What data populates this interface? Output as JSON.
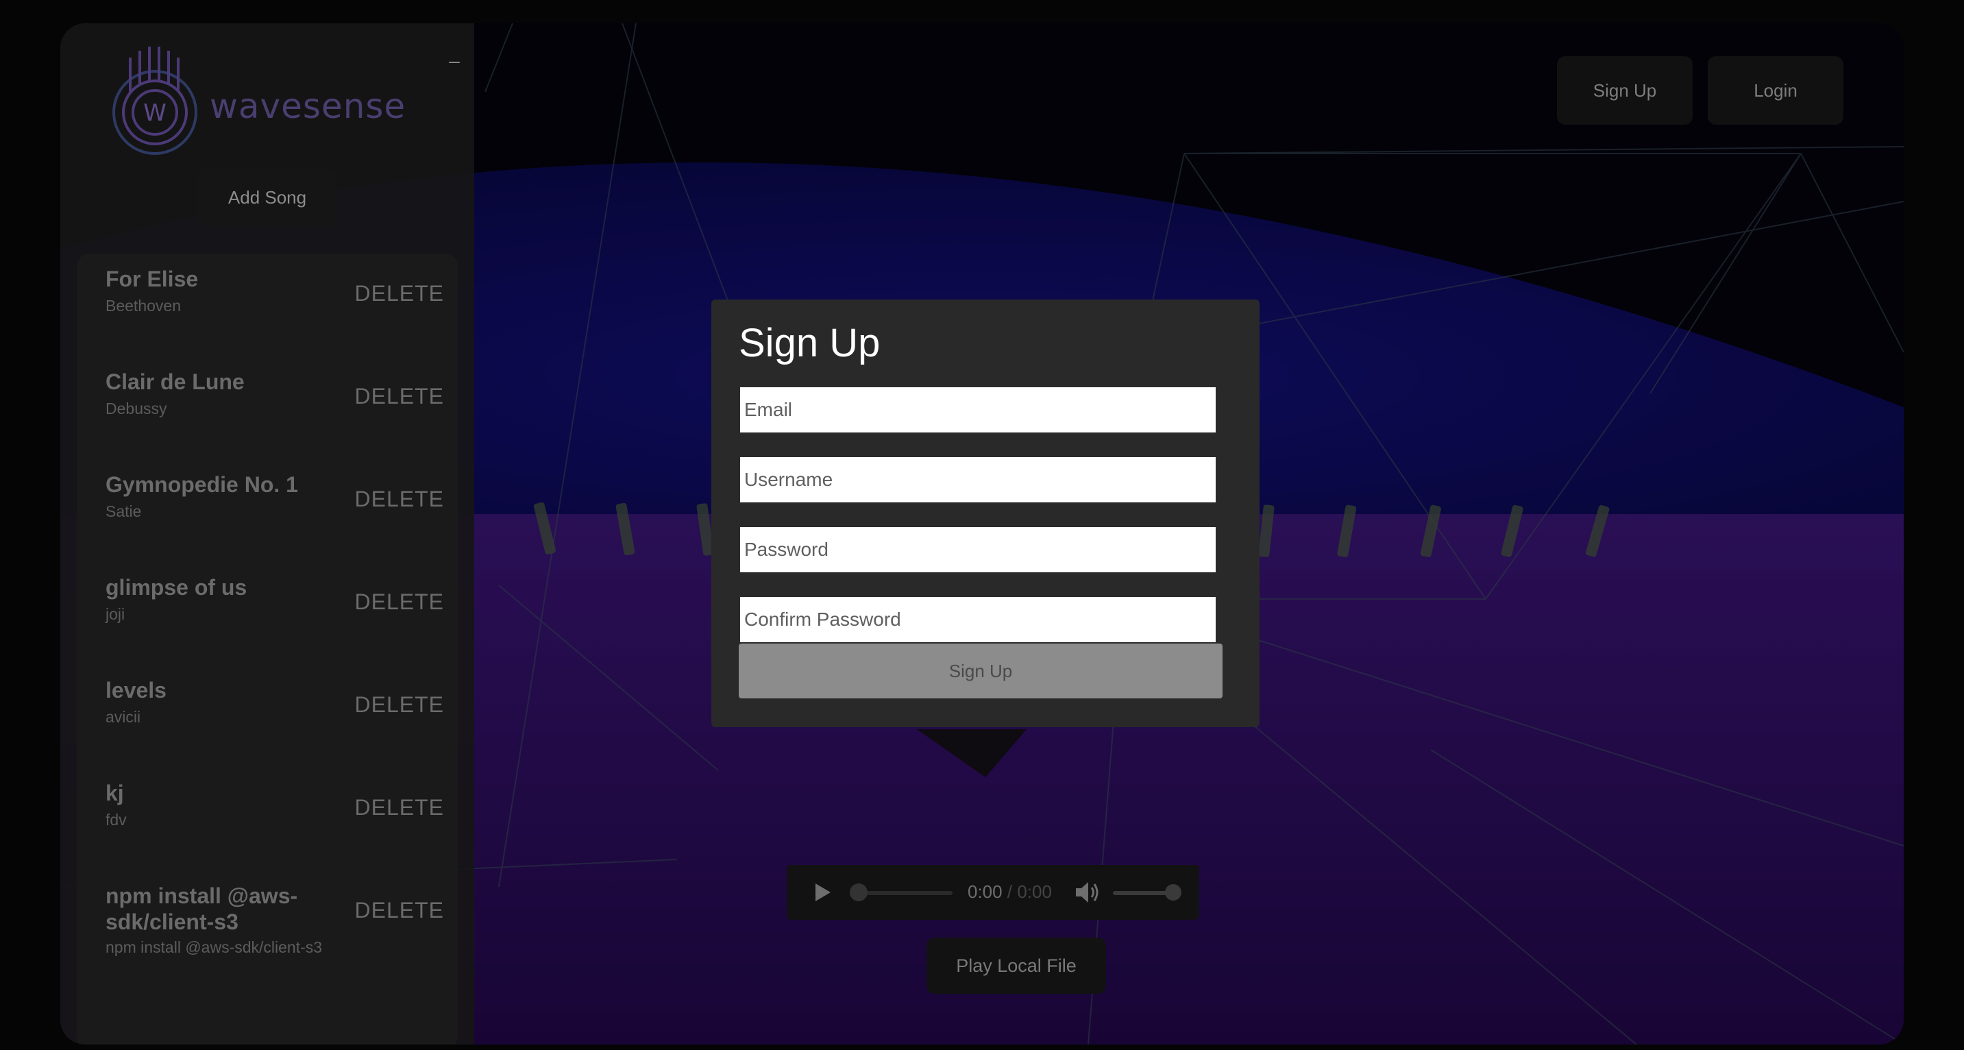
{
  "app": {
    "brand": "wavesense",
    "logo_letter": "W"
  },
  "sidebar": {
    "minimize_label": "–",
    "add_song_label": "Add Song",
    "songs": [
      {
        "title": "For Elise",
        "artist": "Beethoven",
        "delete_label": "DELETE"
      },
      {
        "title": "Clair de Lune",
        "artist": "Debussy",
        "delete_label": "DELETE"
      },
      {
        "title": "Gymnopedie No. 1",
        "artist": "Satie",
        "delete_label": "DELETE"
      },
      {
        "title": "glimpse of us",
        "artist": "joji",
        "delete_label": "DELETE"
      },
      {
        "title": "levels",
        "artist": "avicii",
        "delete_label": "DELETE"
      },
      {
        "title": "kj",
        "artist": "fdv",
        "delete_label": "DELETE"
      },
      {
        "title": "npm install @aws-sdk/client-s3",
        "artist": "npm install @aws-sdk/client-s3",
        "delete_label": "DELETE"
      }
    ]
  },
  "header": {
    "signup_label": "Sign Up",
    "login_label": "Login"
  },
  "modal": {
    "title": "Sign Up",
    "email_placeholder": "Email",
    "username_placeholder": "Username",
    "password_placeholder": "Password",
    "confirm_placeholder": "Confirm Password",
    "submit_label": "Sign Up"
  },
  "player": {
    "current_time": "0:00",
    "separator": "/",
    "duration": "0:00",
    "volume": 1.0,
    "progress": 0.0
  },
  "play_local_label": "Play Local File",
  "colors": {
    "sky": "#0c0a4a",
    "floor": "#2c0f5c",
    "accent_logo": "#5b4a8a",
    "modal_bg": "#292929"
  },
  "icons": [
    "play-icon",
    "volume-icon",
    "minimize-icon"
  ]
}
